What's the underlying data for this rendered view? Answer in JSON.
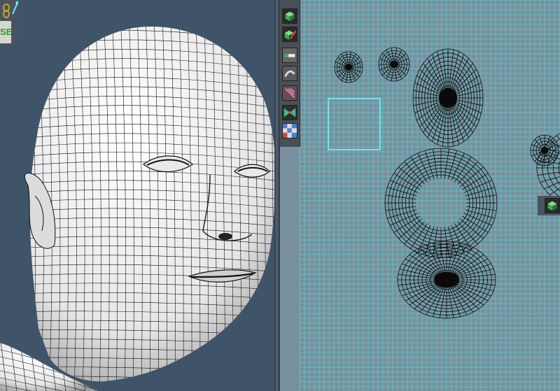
{
  "viewport": {
    "background": "#3f5468",
    "mesh_stroke": "#111111",
    "mesh_fill": "#f4f4f4"
  },
  "corner_tools": {
    "se_label": "SE",
    "icons": [
      "chain-icon",
      "manipulator-icon"
    ]
  },
  "uv_editor": {
    "background": "#78909e",
    "grid_color": "#5fd6d4",
    "tools": [
      {
        "name": "uv-cube-icon",
        "color": "#3faa55"
      },
      {
        "name": "uv-cube-edit-icon",
        "color": "#3faa55"
      },
      {
        "name": "uv-move-icon",
        "color": "#d9d9d9"
      },
      {
        "name": "uv-smudge-icon",
        "color": "#b0b0b0"
      },
      {
        "name": "uv-layout-icon",
        "color": "#d07090"
      },
      {
        "name": "uv-unfold-icon",
        "color": "#40c080"
      },
      {
        "name": "uv-checker-icon",
        "color": "#4d7fd0"
      }
    ],
    "side_tool": "uv-cube-icon"
  }
}
